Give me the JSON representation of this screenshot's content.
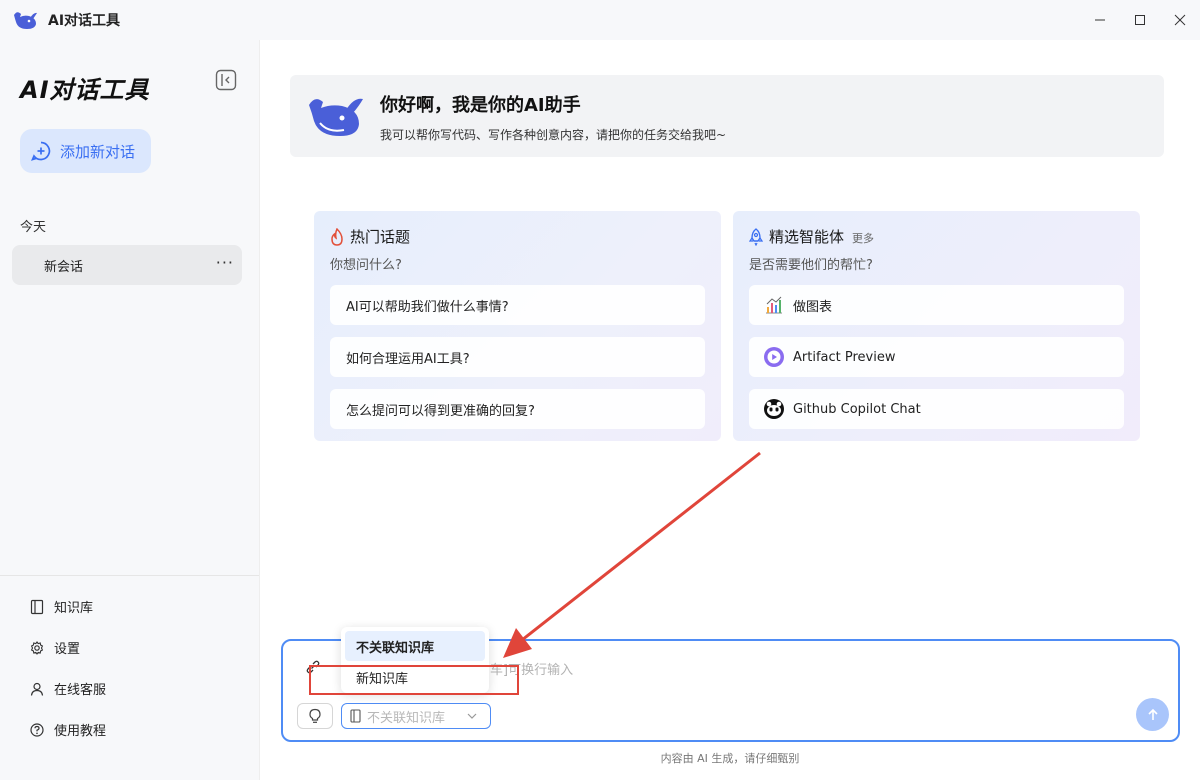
{
  "app": {
    "title": "AI对话工具"
  },
  "sidebar": {
    "brand": "AI对话工具",
    "new_chat_label": "添加新对话",
    "section_today": "今天",
    "sessions": [
      {
        "label": "新会话",
        "more": "···"
      }
    ],
    "links": [
      {
        "label": "知识库",
        "icon": "book-icon"
      },
      {
        "label": "设置",
        "icon": "gear-icon"
      },
      {
        "label": "在线客服",
        "icon": "user-icon"
      },
      {
        "label": "使用教程",
        "icon": "help-icon"
      }
    ]
  },
  "welcome": {
    "title": "你好啊，我是你的AI助手",
    "subtitle": "我可以帮你写代码、写作各种创意内容，请把你的任务交给我吧~"
  },
  "hot_topics": {
    "title": "热门话题",
    "subtitle": "你想问什么?",
    "items": [
      "AI可以帮助我们做什么事情?",
      "如何合理运用AI工具?",
      "怎么提问可以得到更准确的回复?"
    ]
  },
  "agents": {
    "title": "精选智能体",
    "more": "更多",
    "subtitle": "是否需要他们的帮忙?",
    "items": [
      {
        "label": "做图表",
        "icon": "chart-icon"
      },
      {
        "label": "Artifact Preview",
        "icon": "play-icon"
      },
      {
        "label": "Github Copilot Chat",
        "icon": "copilot-icon"
      }
    ]
  },
  "input": {
    "placeholder_visible": "车]可换行输入",
    "knowledge_select": "不关联知识库"
  },
  "dropdown": {
    "options": [
      "不关联知识库",
      "新知识库"
    ],
    "selected": "不关联知识库"
  },
  "footer": {
    "note": "内容由 AI 生成，请仔细甄别"
  },
  "colors": {
    "accent": "#4f8cf5",
    "annotation": "#e0453a"
  }
}
